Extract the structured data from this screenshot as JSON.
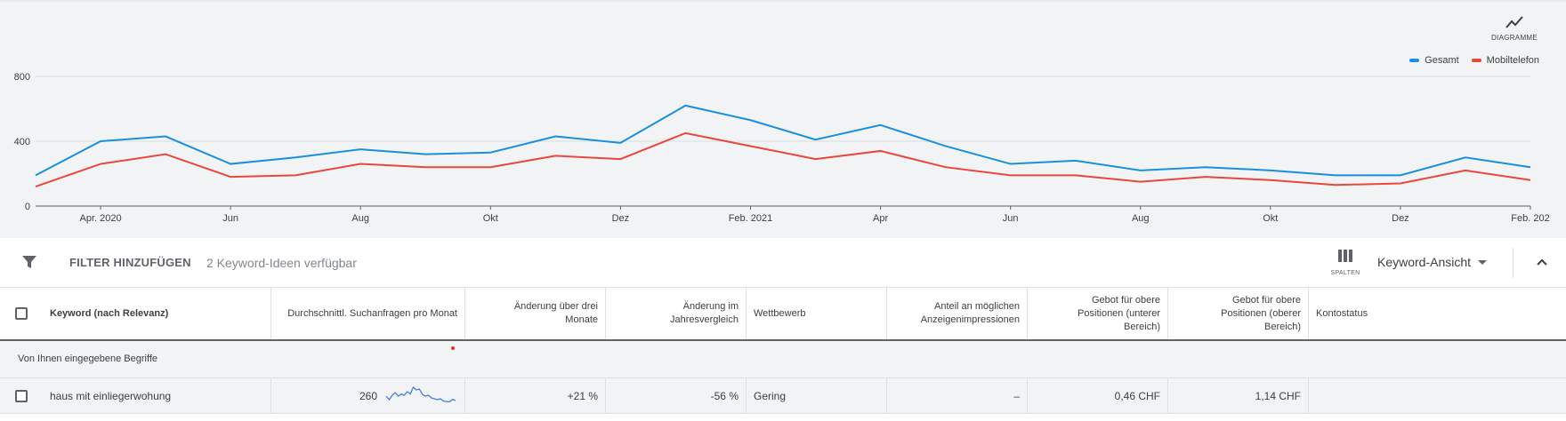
{
  "chart_toggle": {
    "label": "DIAGRAMME",
    "icon": "trend-chart-icon"
  },
  "legend": [
    {
      "name": "Gesamt",
      "color": "#1a8fdb"
    },
    {
      "name": "Mobiltelefon",
      "color": "#e8473b"
    }
  ],
  "chart_data": {
    "type": "line",
    "x": [
      "2020-03",
      "2020-04",
      "2020-05",
      "2020-06",
      "2020-07",
      "2020-08",
      "2020-09",
      "2020-10",
      "2020-11",
      "2020-12",
      "2021-01",
      "2021-02",
      "2021-03",
      "2021-04",
      "2021-05",
      "2021-06",
      "2021-07",
      "2021-08",
      "2021-09",
      "2021-10",
      "2021-11",
      "2021-12",
      "2022-01",
      "2022-02"
    ],
    "x_tick_labels": [
      "Apr. 2020",
      "Jun",
      "Aug",
      "Okt",
      "Dez",
      "Feb. 2021",
      "Apr",
      "Jun",
      "Aug",
      "Okt",
      "Dez",
      "Feb. 202"
    ],
    "x_tick_indices": [
      1,
      3,
      5,
      7,
      9,
      11,
      13,
      15,
      17,
      19,
      21,
      23
    ],
    "y_ticks": [
      0,
      400,
      800
    ],
    "ylim": [
      0,
      800
    ],
    "series": [
      {
        "name": "Gesamt",
        "color": "#1a8fdb",
        "values": [
          190,
          400,
          430,
          260,
          300,
          350,
          320,
          330,
          430,
          390,
          620,
          530,
          410,
          500,
          370,
          260,
          280,
          220,
          240,
          220,
          190,
          190,
          300,
          240
        ]
      },
      {
        "name": "Mobiltelefon",
        "color": "#e8473b",
        "values": [
          120,
          260,
          320,
          180,
          190,
          260,
          240,
          240,
          310,
          290,
          450,
          370,
          290,
          340,
          240,
          190,
          190,
          150,
          180,
          160,
          130,
          140,
          220,
          160
        ]
      }
    ],
    "legend_position": "top-right",
    "grid": true
  },
  "toolbar": {
    "filter_icon": "filter-icon",
    "filter_label": "FILTER HINZUFÜGEN",
    "ideas_text": "2 Keyword-Ideen verfügbar",
    "columns_icon": "columns-icon",
    "columns_label": "SPALTEN",
    "view_label": "Keyword-Ansicht",
    "collapse_icon": "chevron-up-icon"
  },
  "columns": [
    "Keyword (nach Relevanz)",
    "Durchschnittl. Suchanfragen pro Monat",
    "Änderung über drei Monate",
    "Änderung im Jahresvergleich",
    "Wettbewerb",
    "Anteil an möglichen Anzeigenimpressionen",
    "Gebot für obere Positionen (unterer Bereich)",
    "Gebot für obere Positionen (oberer Bereich)",
    "Kontostatus"
  ],
  "section_label": "Von Ihnen eingegebene Begriffe",
  "rows": [
    {
      "keyword": "haus mit einliegerwohung",
      "avg_searches": "260",
      "trend": [
        0.5,
        0.3,
        0.55,
        0.7,
        0.5,
        0.62,
        0.55,
        0.75,
        0.62,
        1.0,
        0.85,
        0.9,
        0.6,
        0.5,
        0.55,
        0.4,
        0.35,
        0.3,
        0.35,
        0.22,
        0.2,
        0.18,
        0.32,
        0.25
      ],
      "three_month_change": "+21 %",
      "yoy_change": "-56 %",
      "competition": "Gering",
      "impression_share": "–",
      "bid_low": "0,46 CHF",
      "bid_high": "1,14 CHF",
      "account_status": ""
    }
  ]
}
